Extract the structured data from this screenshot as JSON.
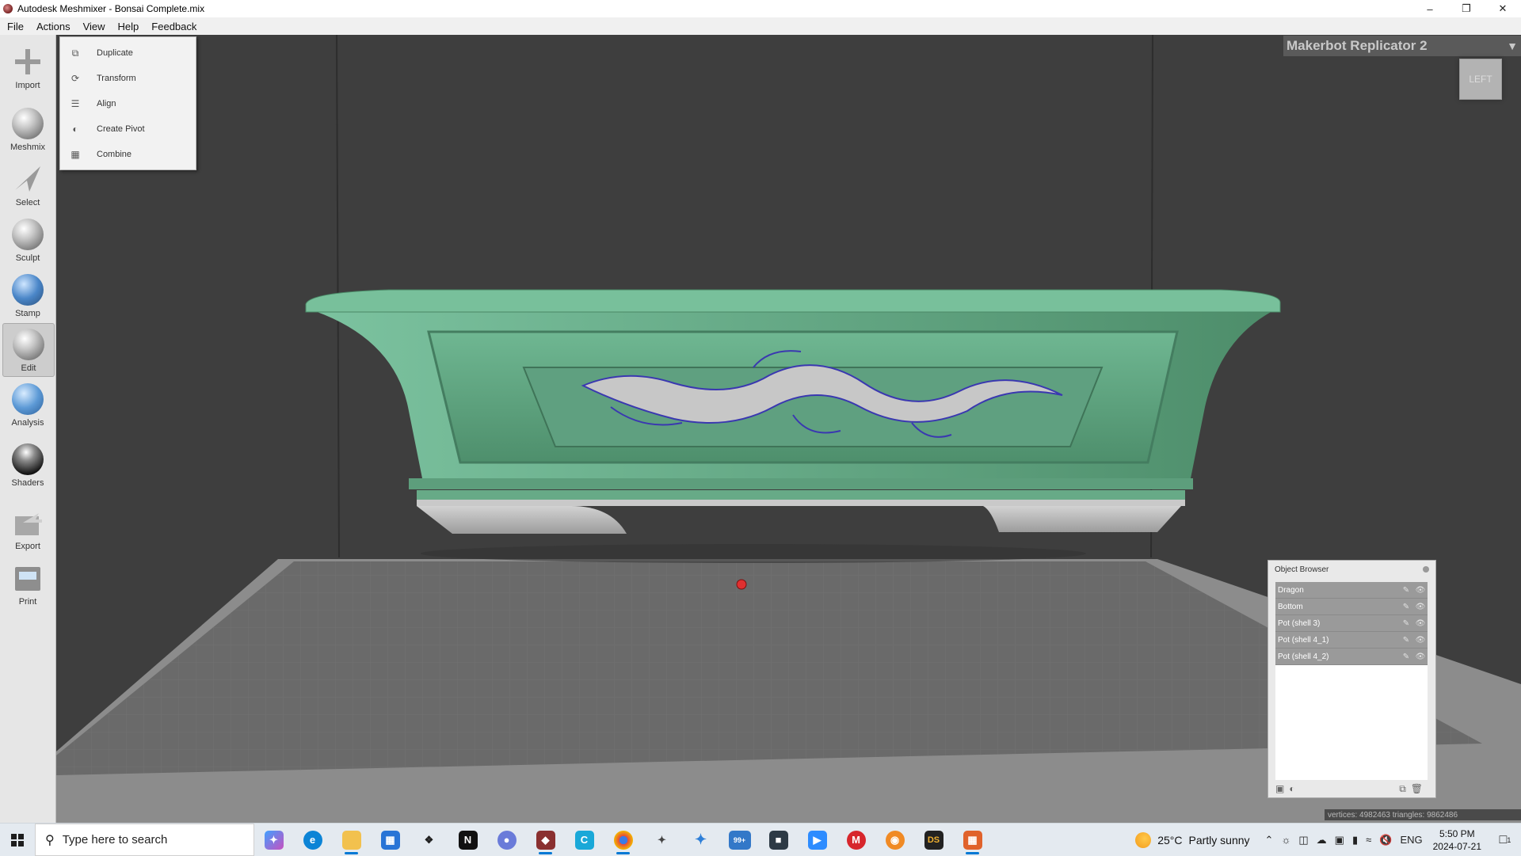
{
  "window": {
    "title": "Autodesk Meshmixer - Bonsai Complete.mix"
  },
  "menu": [
    "File",
    "Actions",
    "View",
    "Help",
    "Feedback"
  ],
  "tools": [
    {
      "label": "Import",
      "icon": "plus-icon"
    },
    {
      "label": "Meshmix",
      "icon": "face-sphere-icon"
    },
    {
      "label": "Select",
      "icon": "arrow-icon"
    },
    {
      "label": "Sculpt",
      "icon": "brush-sphere-icon"
    },
    {
      "label": "Stamp",
      "icon": "stamp-sphere-icon"
    },
    {
      "label": "Edit",
      "icon": "edit-sphere-icon"
    },
    {
      "label": "Analysis",
      "icon": "wire-sphere-icon"
    },
    {
      "label": "Shaders",
      "icon": "shader-sphere-icon"
    },
    {
      "label": "Export",
      "icon": "export-icon"
    },
    {
      "label": "Print",
      "icon": "printer-icon"
    }
  ],
  "actions_menu": [
    {
      "label": "Duplicate",
      "icon": "duplicate-icon"
    },
    {
      "label": "Transform",
      "icon": "transform-icon"
    },
    {
      "label": "Align",
      "icon": "align-icon"
    },
    {
      "label": "Create Pivot",
      "icon": "pivot-icon"
    },
    {
      "label": "Combine",
      "icon": "combine-icon"
    }
  ],
  "printer": {
    "name": "Makerbot Replicator 2"
  },
  "viewcube": {
    "face": "LEFT"
  },
  "object_browser": {
    "title": "Object Browser",
    "objects": [
      "Dragon",
      "Bottom",
      "Pot (shell 3)",
      "Pot (shell 4_1)",
      "Pot (shell 4_2)"
    ]
  },
  "stats": "vertices: 4982463 triangles: 9862486",
  "taskbar": {
    "search_placeholder": "Type here to search",
    "weather_temp": "25°C",
    "weather_cond": "Partly sunny",
    "lang": "ENG",
    "time": "5:50 PM",
    "date": "2024-07-21",
    "mail_badge": "99+",
    "notif_count": "1"
  },
  "colors": {
    "pot": "#5ea27f",
    "platform": "#6a6a6a",
    "background": "#3e3e3e"
  }
}
